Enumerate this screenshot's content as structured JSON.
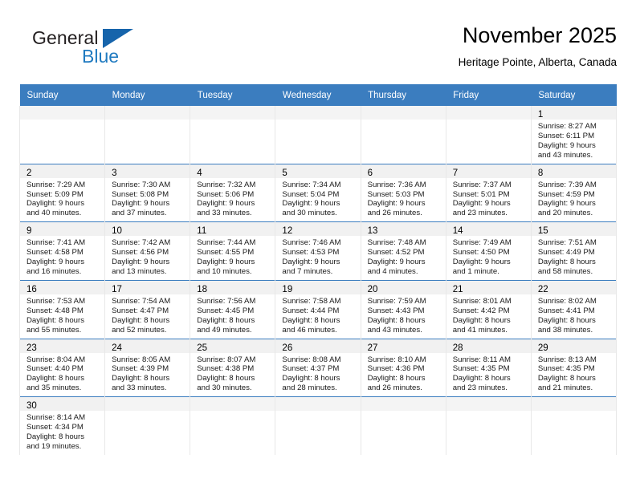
{
  "brand": {
    "name_part1": "General",
    "name_part2": "Blue",
    "flag_icon": "triangle-flag-icon",
    "accent_color": "#1f7ac0",
    "flag_color": "#1664ab"
  },
  "header": {
    "month_title": "November 2025",
    "location": "Heritage Pointe, Alberta, Canada"
  },
  "calendar": {
    "header_bg": "#3b7dbf",
    "daynum_bg": "#f1f1f1",
    "weekday_headers": [
      "Sunday",
      "Monday",
      "Tuesday",
      "Wednesday",
      "Thursday",
      "Friday",
      "Saturday"
    ],
    "weeks": [
      [
        {
          "day": "",
          "lines": []
        },
        {
          "day": "",
          "lines": []
        },
        {
          "day": "",
          "lines": []
        },
        {
          "day": "",
          "lines": []
        },
        {
          "day": "",
          "lines": []
        },
        {
          "day": "",
          "lines": []
        },
        {
          "day": "1",
          "lines": [
            "Sunrise: 8:27 AM",
            "Sunset: 6:11 PM",
            "Daylight: 9 hours",
            "and 43 minutes."
          ]
        }
      ],
      [
        {
          "day": "2",
          "lines": [
            "Sunrise: 7:29 AM",
            "Sunset: 5:09 PM",
            "Daylight: 9 hours",
            "and 40 minutes."
          ]
        },
        {
          "day": "3",
          "lines": [
            "Sunrise: 7:30 AM",
            "Sunset: 5:08 PM",
            "Daylight: 9 hours",
            "and 37 minutes."
          ]
        },
        {
          "day": "4",
          "lines": [
            "Sunrise: 7:32 AM",
            "Sunset: 5:06 PM",
            "Daylight: 9 hours",
            "and 33 minutes."
          ]
        },
        {
          "day": "5",
          "lines": [
            "Sunrise: 7:34 AM",
            "Sunset: 5:04 PM",
            "Daylight: 9 hours",
            "and 30 minutes."
          ]
        },
        {
          "day": "6",
          "lines": [
            "Sunrise: 7:36 AM",
            "Sunset: 5:03 PM",
            "Daylight: 9 hours",
            "and 26 minutes."
          ]
        },
        {
          "day": "7",
          "lines": [
            "Sunrise: 7:37 AM",
            "Sunset: 5:01 PM",
            "Daylight: 9 hours",
            "and 23 minutes."
          ]
        },
        {
          "day": "8",
          "lines": [
            "Sunrise: 7:39 AM",
            "Sunset: 4:59 PM",
            "Daylight: 9 hours",
            "and 20 minutes."
          ]
        }
      ],
      [
        {
          "day": "9",
          "lines": [
            "Sunrise: 7:41 AM",
            "Sunset: 4:58 PM",
            "Daylight: 9 hours",
            "and 16 minutes."
          ]
        },
        {
          "day": "10",
          "lines": [
            "Sunrise: 7:42 AM",
            "Sunset: 4:56 PM",
            "Daylight: 9 hours",
            "and 13 minutes."
          ]
        },
        {
          "day": "11",
          "lines": [
            "Sunrise: 7:44 AM",
            "Sunset: 4:55 PM",
            "Daylight: 9 hours",
            "and 10 minutes."
          ]
        },
        {
          "day": "12",
          "lines": [
            "Sunrise: 7:46 AM",
            "Sunset: 4:53 PM",
            "Daylight: 9 hours",
            "and 7 minutes."
          ]
        },
        {
          "day": "13",
          "lines": [
            "Sunrise: 7:48 AM",
            "Sunset: 4:52 PM",
            "Daylight: 9 hours",
            "and 4 minutes."
          ]
        },
        {
          "day": "14",
          "lines": [
            "Sunrise: 7:49 AM",
            "Sunset: 4:50 PM",
            "Daylight: 9 hours",
            "and 1 minute."
          ]
        },
        {
          "day": "15",
          "lines": [
            "Sunrise: 7:51 AM",
            "Sunset: 4:49 PM",
            "Daylight: 8 hours",
            "and 58 minutes."
          ]
        }
      ],
      [
        {
          "day": "16",
          "lines": [
            "Sunrise: 7:53 AM",
            "Sunset: 4:48 PM",
            "Daylight: 8 hours",
            "and 55 minutes."
          ]
        },
        {
          "day": "17",
          "lines": [
            "Sunrise: 7:54 AM",
            "Sunset: 4:47 PM",
            "Daylight: 8 hours",
            "and 52 minutes."
          ]
        },
        {
          "day": "18",
          "lines": [
            "Sunrise: 7:56 AM",
            "Sunset: 4:45 PM",
            "Daylight: 8 hours",
            "and 49 minutes."
          ]
        },
        {
          "day": "19",
          "lines": [
            "Sunrise: 7:58 AM",
            "Sunset: 4:44 PM",
            "Daylight: 8 hours",
            "and 46 minutes."
          ]
        },
        {
          "day": "20",
          "lines": [
            "Sunrise: 7:59 AM",
            "Sunset: 4:43 PM",
            "Daylight: 8 hours",
            "and 43 minutes."
          ]
        },
        {
          "day": "21",
          "lines": [
            "Sunrise: 8:01 AM",
            "Sunset: 4:42 PM",
            "Daylight: 8 hours",
            "and 41 minutes."
          ]
        },
        {
          "day": "22",
          "lines": [
            "Sunrise: 8:02 AM",
            "Sunset: 4:41 PM",
            "Daylight: 8 hours",
            "and 38 minutes."
          ]
        }
      ],
      [
        {
          "day": "23",
          "lines": [
            "Sunrise: 8:04 AM",
            "Sunset: 4:40 PM",
            "Daylight: 8 hours",
            "and 35 minutes."
          ]
        },
        {
          "day": "24",
          "lines": [
            "Sunrise: 8:05 AM",
            "Sunset: 4:39 PM",
            "Daylight: 8 hours",
            "and 33 minutes."
          ]
        },
        {
          "day": "25",
          "lines": [
            "Sunrise: 8:07 AM",
            "Sunset: 4:38 PM",
            "Daylight: 8 hours",
            "and 30 minutes."
          ]
        },
        {
          "day": "26",
          "lines": [
            "Sunrise: 8:08 AM",
            "Sunset: 4:37 PM",
            "Daylight: 8 hours",
            "and 28 minutes."
          ]
        },
        {
          "day": "27",
          "lines": [
            "Sunrise: 8:10 AM",
            "Sunset: 4:36 PM",
            "Daylight: 8 hours",
            "and 26 minutes."
          ]
        },
        {
          "day": "28",
          "lines": [
            "Sunrise: 8:11 AM",
            "Sunset: 4:35 PM",
            "Daylight: 8 hours",
            "and 23 minutes."
          ]
        },
        {
          "day": "29",
          "lines": [
            "Sunrise: 8:13 AM",
            "Sunset: 4:35 PM",
            "Daylight: 8 hours",
            "and 21 minutes."
          ]
        }
      ],
      [
        {
          "day": "30",
          "lines": [
            "Sunrise: 8:14 AM",
            "Sunset: 4:34 PM",
            "Daylight: 8 hours",
            "and 19 minutes."
          ]
        },
        {
          "day": "",
          "lines": []
        },
        {
          "day": "",
          "lines": []
        },
        {
          "day": "",
          "lines": []
        },
        {
          "day": "",
          "lines": []
        },
        {
          "day": "",
          "lines": []
        },
        {
          "day": "",
          "lines": []
        }
      ]
    ]
  }
}
